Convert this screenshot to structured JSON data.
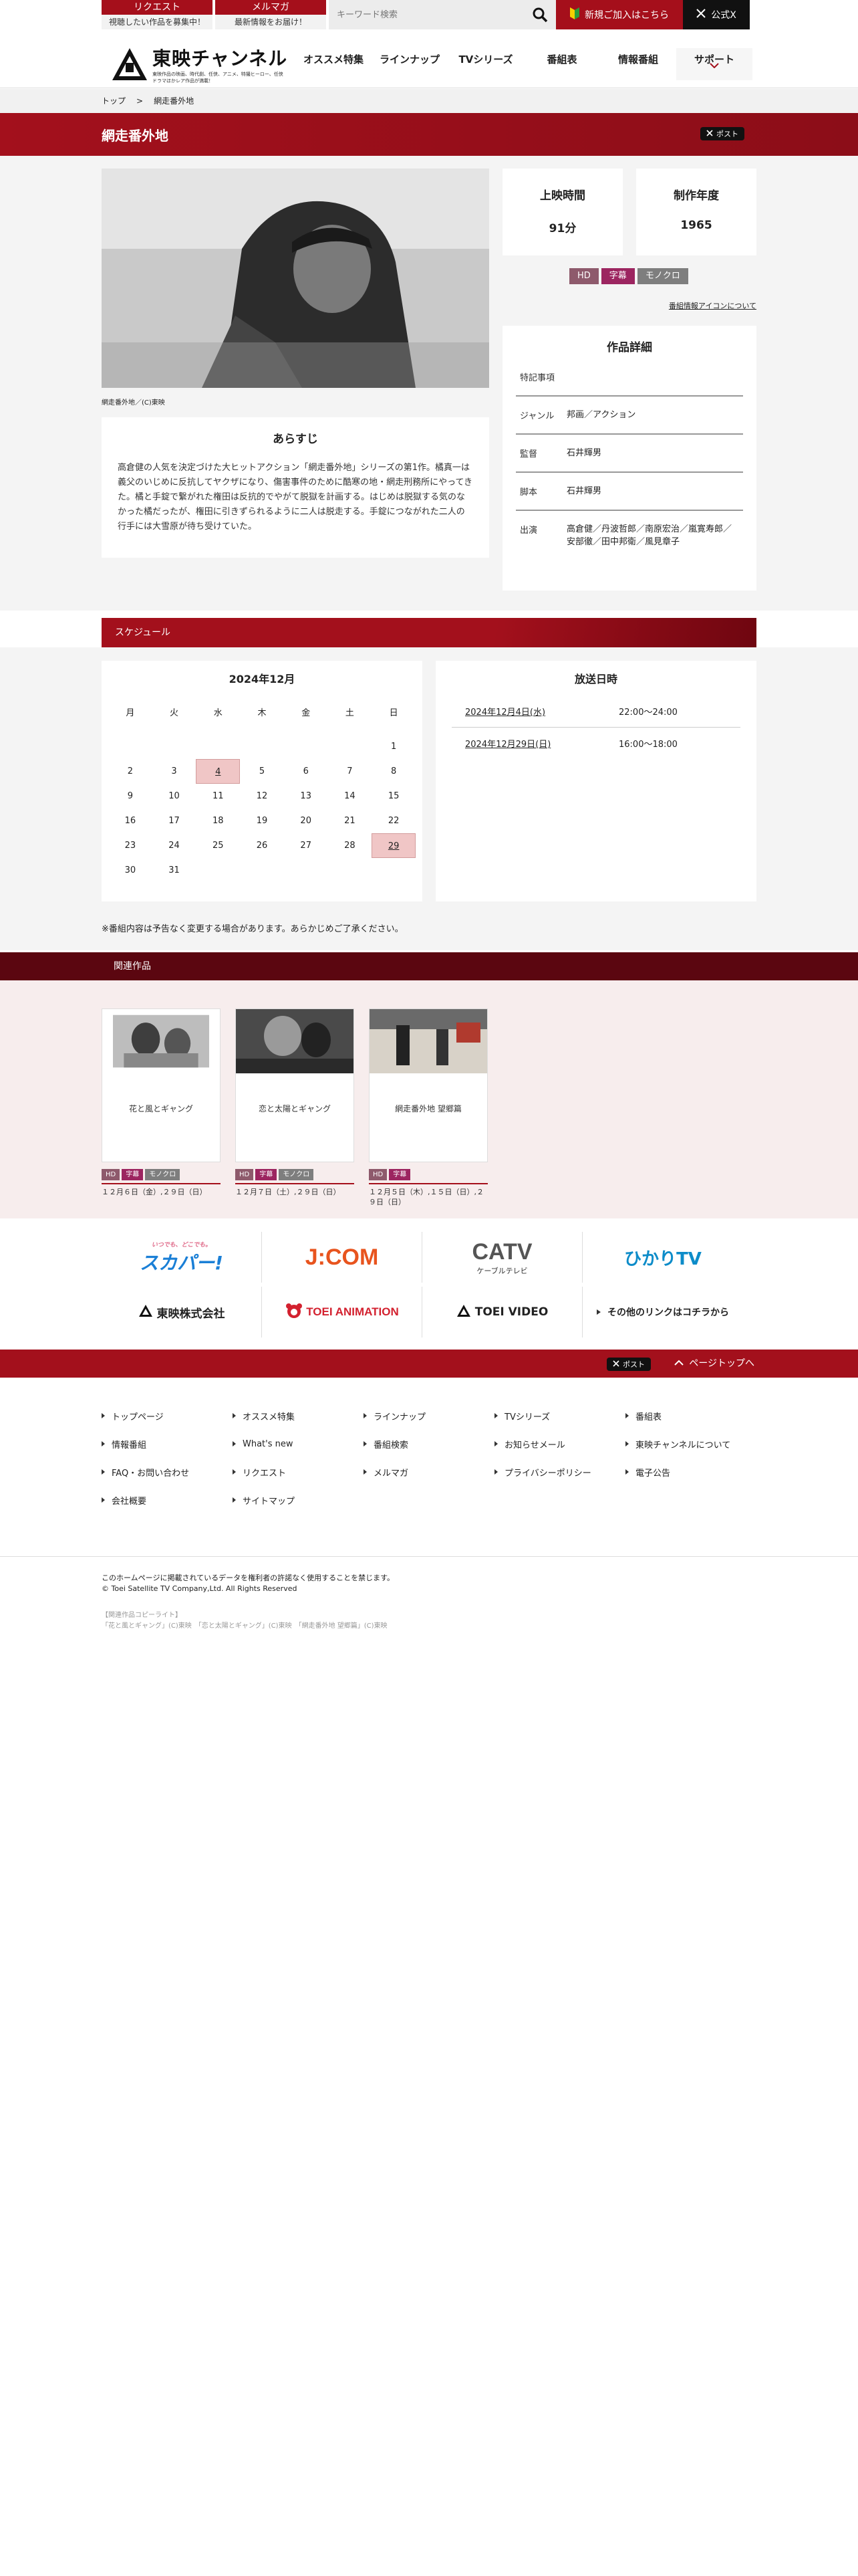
{
  "topbar": {
    "request_label": "リクエスト",
    "request_sub": "視聴したい作品を募集中！",
    "magazine_label": "メルマガ",
    "magazine_sub": "最新情報をお届け！",
    "search_placeholder": "キーワード検索",
    "newjoin_label": "新規ご加入はこちら",
    "x_label": "公式X"
  },
  "header": {
    "logo_title": "東映チャンネル",
    "logo_tagline": "東映作品の映画、時代劇、任侠、アニメ、特撮ヒーロー、任侠ドラマほかレア作品が満載！",
    "nav": [
      "オススメ特集",
      "ラインナップ",
      "TVシリーズ",
      "番組表",
      "情報番組",
      "サポート"
    ]
  },
  "breadcrumb": [
    "トップ",
    ">",
    "網走番外地"
  ],
  "title": "網走番外地",
  "x_post_label": "ポスト",
  "photo_caption": "網走番外地／(C)東映",
  "synopsis": {
    "heading": "あらすじ",
    "text": "高倉健の人気を決定づけた大ヒットアクション「網走番外地」シリーズの第1作。橘真一は義父のいじめに反抗してヤクザになり、傷害事件のために酷寒の地・網走刑務所にやってきた。橘と手錠で繋がれた権田は反抗的でやがて脱獄を計画する。はじめは脱獄する気のなかった橘だったが、権田に引きずられるように二人は脱走する。手錠につながれた二人の行手には大雪原が待ち受けていた。"
  },
  "stats": [
    {
      "label": "上映時間",
      "value": "91分"
    },
    {
      "label": "制作年度",
      "value": "1965"
    }
  ],
  "badges": [
    "HD",
    "字幕",
    "モノクロ"
  ],
  "icon_info_link": "番組情報アイコンについて",
  "details": {
    "heading": "作品詳細",
    "rows": [
      {
        "key": "特記事項",
        "value": ""
      },
      {
        "key": "ジャンル",
        "value": "邦画／アクション"
      },
      {
        "key": "監督",
        "value": "石井輝男"
      },
      {
        "key": "脚本",
        "value": "石井輝男"
      },
      {
        "key": "出演",
        "value": "高倉健／丹波哲郎／南原宏治／嵐寛寿郎／安部徹／田中邦衛／風見章子"
      }
    ]
  },
  "schedule": {
    "section_label": "スケジュール",
    "month": "2024年12月",
    "weekdays": [
      "月",
      "火",
      "水",
      "木",
      "金",
      "土",
      "日"
    ],
    "days": [
      "",
      "",
      "",
      "",
      "",
      "",
      "1",
      "2",
      "3",
      "4",
      "5",
      "6",
      "7",
      "8",
      "9",
      "10",
      "11",
      "12",
      "13",
      "14",
      "15",
      "16",
      "17",
      "18",
      "19",
      "20",
      "21",
      "22",
      "23",
      "24",
      "25",
      "26",
      "27",
      "28",
      "29",
      "30",
      "31",
      "",
      "",
      "",
      "",
      ""
    ],
    "highlight_days": [
      "4",
      "29"
    ],
    "times_heading": "放送日時",
    "times": [
      {
        "date": "2024年12月4日(水)",
        "time": "22:00〜24:00"
      },
      {
        "date": "2024年12月29日(日)",
        "time": "16:00〜18:00"
      }
    ],
    "note": "※番組内容は予告なく変更する場合があります。あらかじめご了承ください。"
  },
  "related": {
    "section_label": "関連作品",
    "items": [
      {
        "title": "花と風とギャング",
        "tags": [
          "HD",
          "字幕",
          "モノクロ"
        ],
        "dates": "１２月６日（金）,２９日（日）"
      },
      {
        "title": "恋と太陽とギャング",
        "tags": [
          "HD",
          "字幕",
          "モノクロ"
        ],
        "dates": "１２月７日（土）,２９日（日）"
      },
      {
        "title": "網走番外地 望郷篇",
        "tags": [
          "HD",
          "字幕"
        ],
        "dates": "１２月５日（木）,１５日（日）,２９日（日）"
      }
    ]
  },
  "partners": {
    "row1": [
      "スカパー!",
      "J:COM",
      "CATV",
      "ひかりTV"
    ],
    "catv_sub": "ケーブルテレビ",
    "skyperfect_tag": "いつでも、どこでも。",
    "row2": [
      "東映株式会社",
      "TOEI ANIMATION",
      "TOEI VIDEO",
      "その他のリンクはコチラから"
    ]
  },
  "footer": {
    "page_top": "ページトップへ",
    "links": [
      "トップページ",
      "オススメ特集",
      "ラインナップ",
      "TVシリーズ",
      "番組表",
      "情報番組",
      "What's new",
      "番組検索",
      "お知らせメール",
      "東映チャンネルについて",
      "FAQ・お問い合わせ",
      "リクエスト",
      "メルマガ",
      "プライバシーポリシー",
      "電子公告",
      "会社概要",
      "サイトマップ"
    ],
    "disclaimer": "このホームページに掲載されているデータを権利者の許諾なく使用することを禁じます。",
    "copyright": "© Toei Satellite TV Company,Ltd. All Rights Reserved",
    "credits_head": "【関連作品コピーライト】",
    "credits": "「花と風とギャング」(C)東映　「恋と太陽とギャング」(C)東映　「網走番外地 望郷篇」(C)東映"
  },
  "colors": {
    "brand_red": "#a3101c",
    "dark_red": "#5b0610",
    "hd": "#8e5a6c",
    "subtitle": "#9c2560",
    "mono": "#7e7e7e"
  }
}
